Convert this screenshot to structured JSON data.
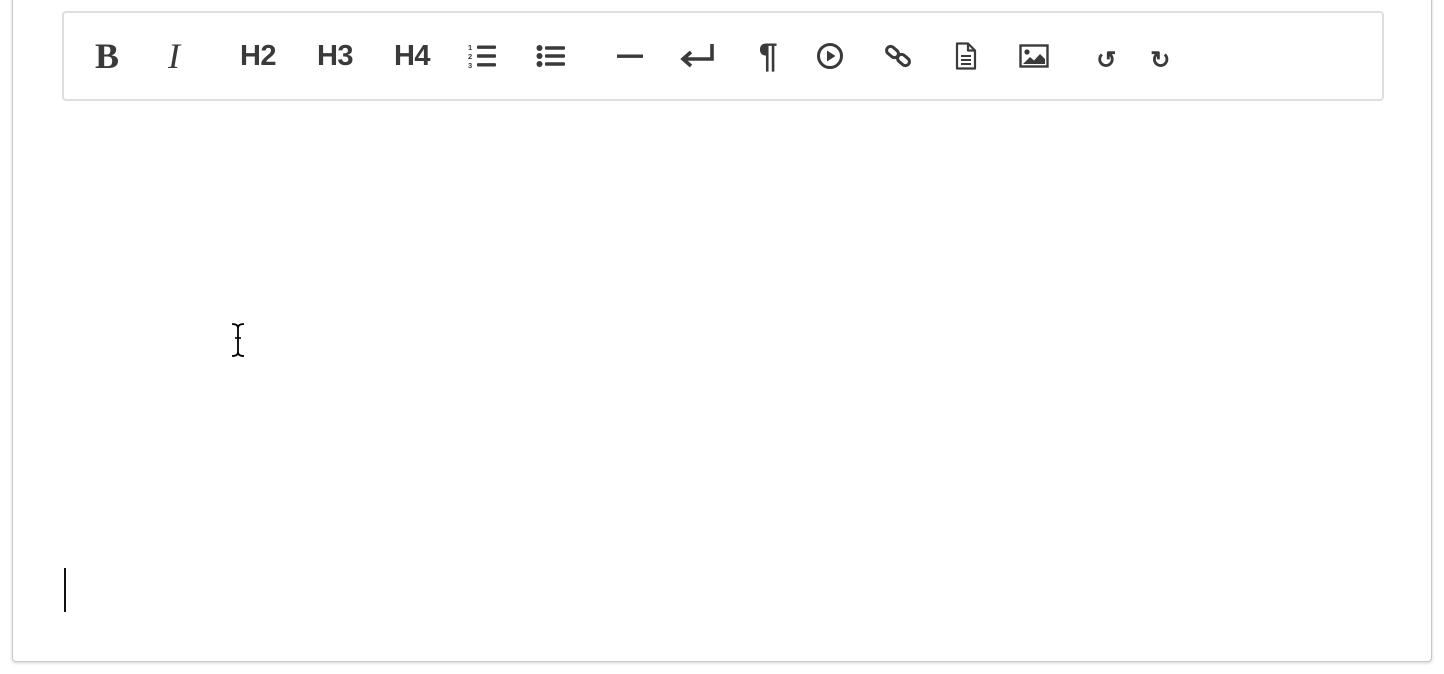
{
  "toolbar": {
    "bold_label": "B",
    "italic_label": "I",
    "h2_label": "H2",
    "h3_label": "H3",
    "h4_label": "H4",
    "paragraph_label": "¶",
    "undo_label": "↺",
    "redo_label": "↻"
  },
  "icons": {
    "bold": "bold-icon",
    "italic": "italic-icon",
    "ordered_list": "ordered-list-icon",
    "unordered_list": "unordered-list-icon",
    "horizontal_rule": "horizontal-rule-icon",
    "line_break": "return-icon",
    "paragraph": "pilcrow-icon",
    "video": "play-circle-icon",
    "link": "link-icon",
    "document": "document-icon",
    "image": "image-icon",
    "undo": "undo-icon",
    "redo": "redo-icon"
  },
  "colors": {
    "icon": "#3a3a3a",
    "toolbar_border": "#dedede",
    "frame_border": "#c8c8c8",
    "background": "#ffffff"
  },
  "editor": {
    "content": ""
  }
}
